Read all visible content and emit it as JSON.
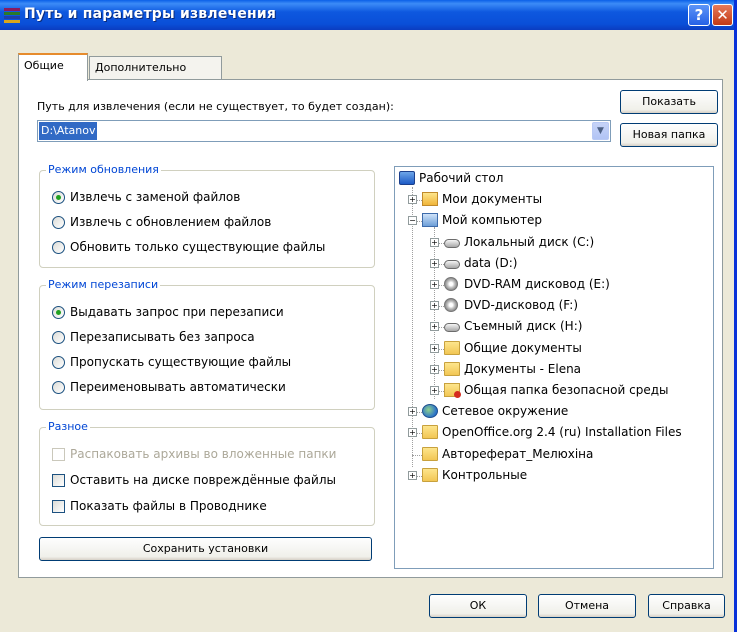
{
  "window": {
    "title": "Путь и параметры извлечения"
  },
  "tabs": [
    "Общие",
    "Дополнительно"
  ],
  "path": {
    "label": "Путь для извлечения (если не существует, то будет создан):",
    "value": "D:\\Atanov"
  },
  "buttons": {
    "show": "Показать",
    "new_folder": "Новая папка",
    "save": "Сохранить установки",
    "ok": "ОК",
    "cancel": "Отмена",
    "help": "Справка"
  },
  "update_mode": {
    "title": "Режим обновления",
    "options": [
      "Извлечь с заменой файлов",
      "Извлечь с обновлением файлов",
      "Обновить только существующие файлы"
    ],
    "selected": 0
  },
  "overwrite_mode": {
    "title": "Режим перезаписи",
    "options": [
      "Выдавать запрос при перезаписи",
      "Перезаписывать без запроса",
      "Пропускать существующие файлы",
      "Переименовывать автоматически"
    ],
    "selected": 0
  },
  "misc": {
    "title": "Разное",
    "options": [
      {
        "label": "Распаковать архивы во вложенные папки",
        "checked": false,
        "disabled": true
      },
      {
        "label": "Оставить на диске повреждённые файлы",
        "checked": false,
        "disabled": false
      },
      {
        "label": "Показать файлы в Проводнике",
        "checked": false,
        "disabled": false
      }
    ]
  },
  "tree": [
    {
      "label": "Рабочий стол",
      "icon": "desktop-icon",
      "level": 0,
      "expander": ""
    },
    {
      "label": "Мои документы",
      "icon": "my-documents-icon",
      "level": 1,
      "expander": "+"
    },
    {
      "label": "Мой компьютер",
      "icon": "my-computer-icon",
      "level": 1,
      "expander": "-"
    },
    {
      "label": "Локальный диск (C:)",
      "icon": "hard-disk-icon",
      "level": 2,
      "expander": "+"
    },
    {
      "label": "data (D:)",
      "icon": "hard-disk-icon",
      "level": 2,
      "expander": "+"
    },
    {
      "label": "DVD-RAM дисковод (E:)",
      "icon": "dvd-drive-icon",
      "level": 2,
      "expander": "+"
    },
    {
      "label": "DVD-дисковод (F:)",
      "icon": "dvd-drive-icon",
      "level": 2,
      "expander": "+"
    },
    {
      "label": "Съемный диск (H:)",
      "icon": "removable-disk-icon",
      "level": 2,
      "expander": "+"
    },
    {
      "label": "Общие документы",
      "icon": "folder-icon",
      "level": 2,
      "expander": "+"
    },
    {
      "label": "Документы - Elena",
      "icon": "folder-icon",
      "level": 2,
      "expander": "+"
    },
    {
      "label": "Общая папка безопасной среды",
      "icon": "secure-folder-icon",
      "level": 2,
      "expander": "+"
    },
    {
      "label": "Сетевое окружение",
      "icon": "network-icon",
      "level": 1,
      "expander": "+"
    },
    {
      "label": "OpenOffice.org 2.4 (ru) Installation Files",
      "icon": "folder-icon",
      "level": 1,
      "expander": "+"
    },
    {
      "label": "Автореферат_Мелюхіна",
      "icon": "folder-icon",
      "level": 1,
      "expander": ""
    },
    {
      "label": "Контрольные",
      "icon": "folder-icon",
      "level": 1,
      "expander": "+"
    }
  ],
  "colors": {
    "title_bar": "#0a4fd8",
    "group_title": "#0046d5",
    "selection": "#316ac5",
    "radio_dot": "#21a121"
  }
}
